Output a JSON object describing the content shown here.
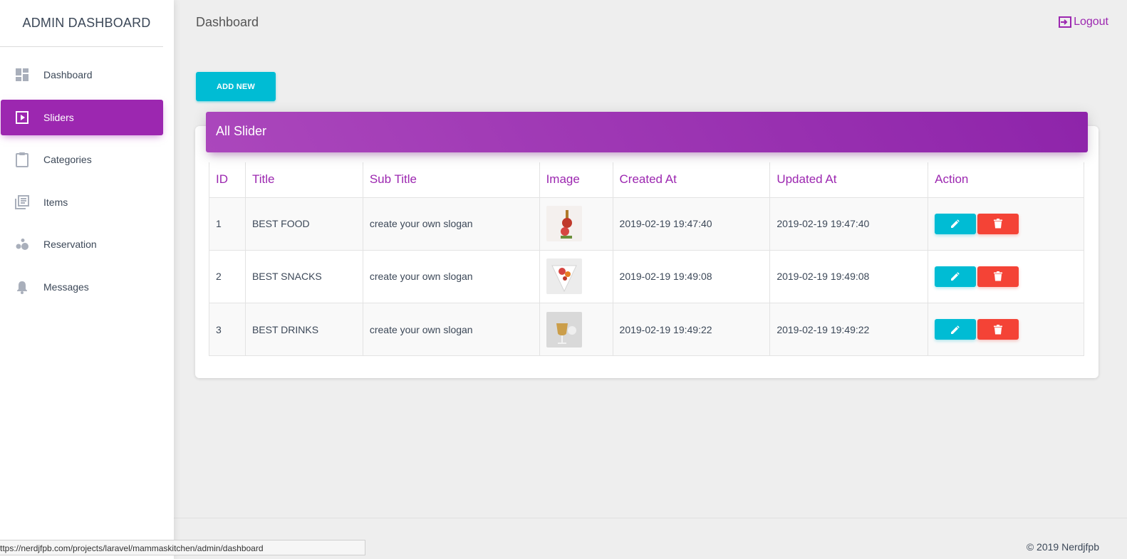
{
  "sidebar": {
    "brand": "ADMIN DASHBOARD",
    "items": [
      {
        "label": "Dashboard",
        "icon": "dashboard-icon",
        "active": false
      },
      {
        "label": "Sliders",
        "icon": "slideshow-icon",
        "active": true
      },
      {
        "label": "Categories",
        "icon": "clipboard-icon",
        "active": false
      },
      {
        "label": "Items",
        "icon": "library-books-icon",
        "active": false
      },
      {
        "label": "Reservation",
        "icon": "bubble-chart-icon",
        "active": false
      },
      {
        "label": "Messages",
        "icon": "bell-icon",
        "active": false
      }
    ]
  },
  "topbar": {
    "title": "Dashboard",
    "logout": "Logout"
  },
  "toolbar": {
    "add_new": "ADD NEW"
  },
  "card": {
    "title": "All Slider",
    "columns": [
      "ID",
      "Title",
      "Sub Title",
      "Image",
      "Created At",
      "Updated At",
      "Action"
    ],
    "rows": [
      {
        "id": "1",
        "title": "BEST FOOD",
        "sub_title": "create your own slogan",
        "image": "food-thumbnail",
        "created_at": "2019-02-19 19:47:40",
        "updated_at": "2019-02-19 19:47:40"
      },
      {
        "id": "2",
        "title": "BEST SNACKS",
        "sub_title": "create your own slogan",
        "image": "snacks-thumbnail",
        "created_at": "2019-02-19 19:49:08",
        "updated_at": "2019-02-19 19:49:08"
      },
      {
        "id": "3",
        "title": "BEST DRINKS",
        "sub_title": "create your own slogan",
        "image": "drinks-thumbnail",
        "created_at": "2019-02-19 19:49:22",
        "updated_at": "2019-02-19 19:49:22"
      }
    ]
  },
  "footer": {
    "copyright": "© 2019 Nerdjfpb"
  },
  "statusbar": {
    "url": "ttps://nerdjfpb.com/projects/laravel/mammaskitchen/admin/dashboard"
  },
  "colors": {
    "primary": "#9c27b0",
    "info": "#00bcd4",
    "danger": "#f44336"
  }
}
